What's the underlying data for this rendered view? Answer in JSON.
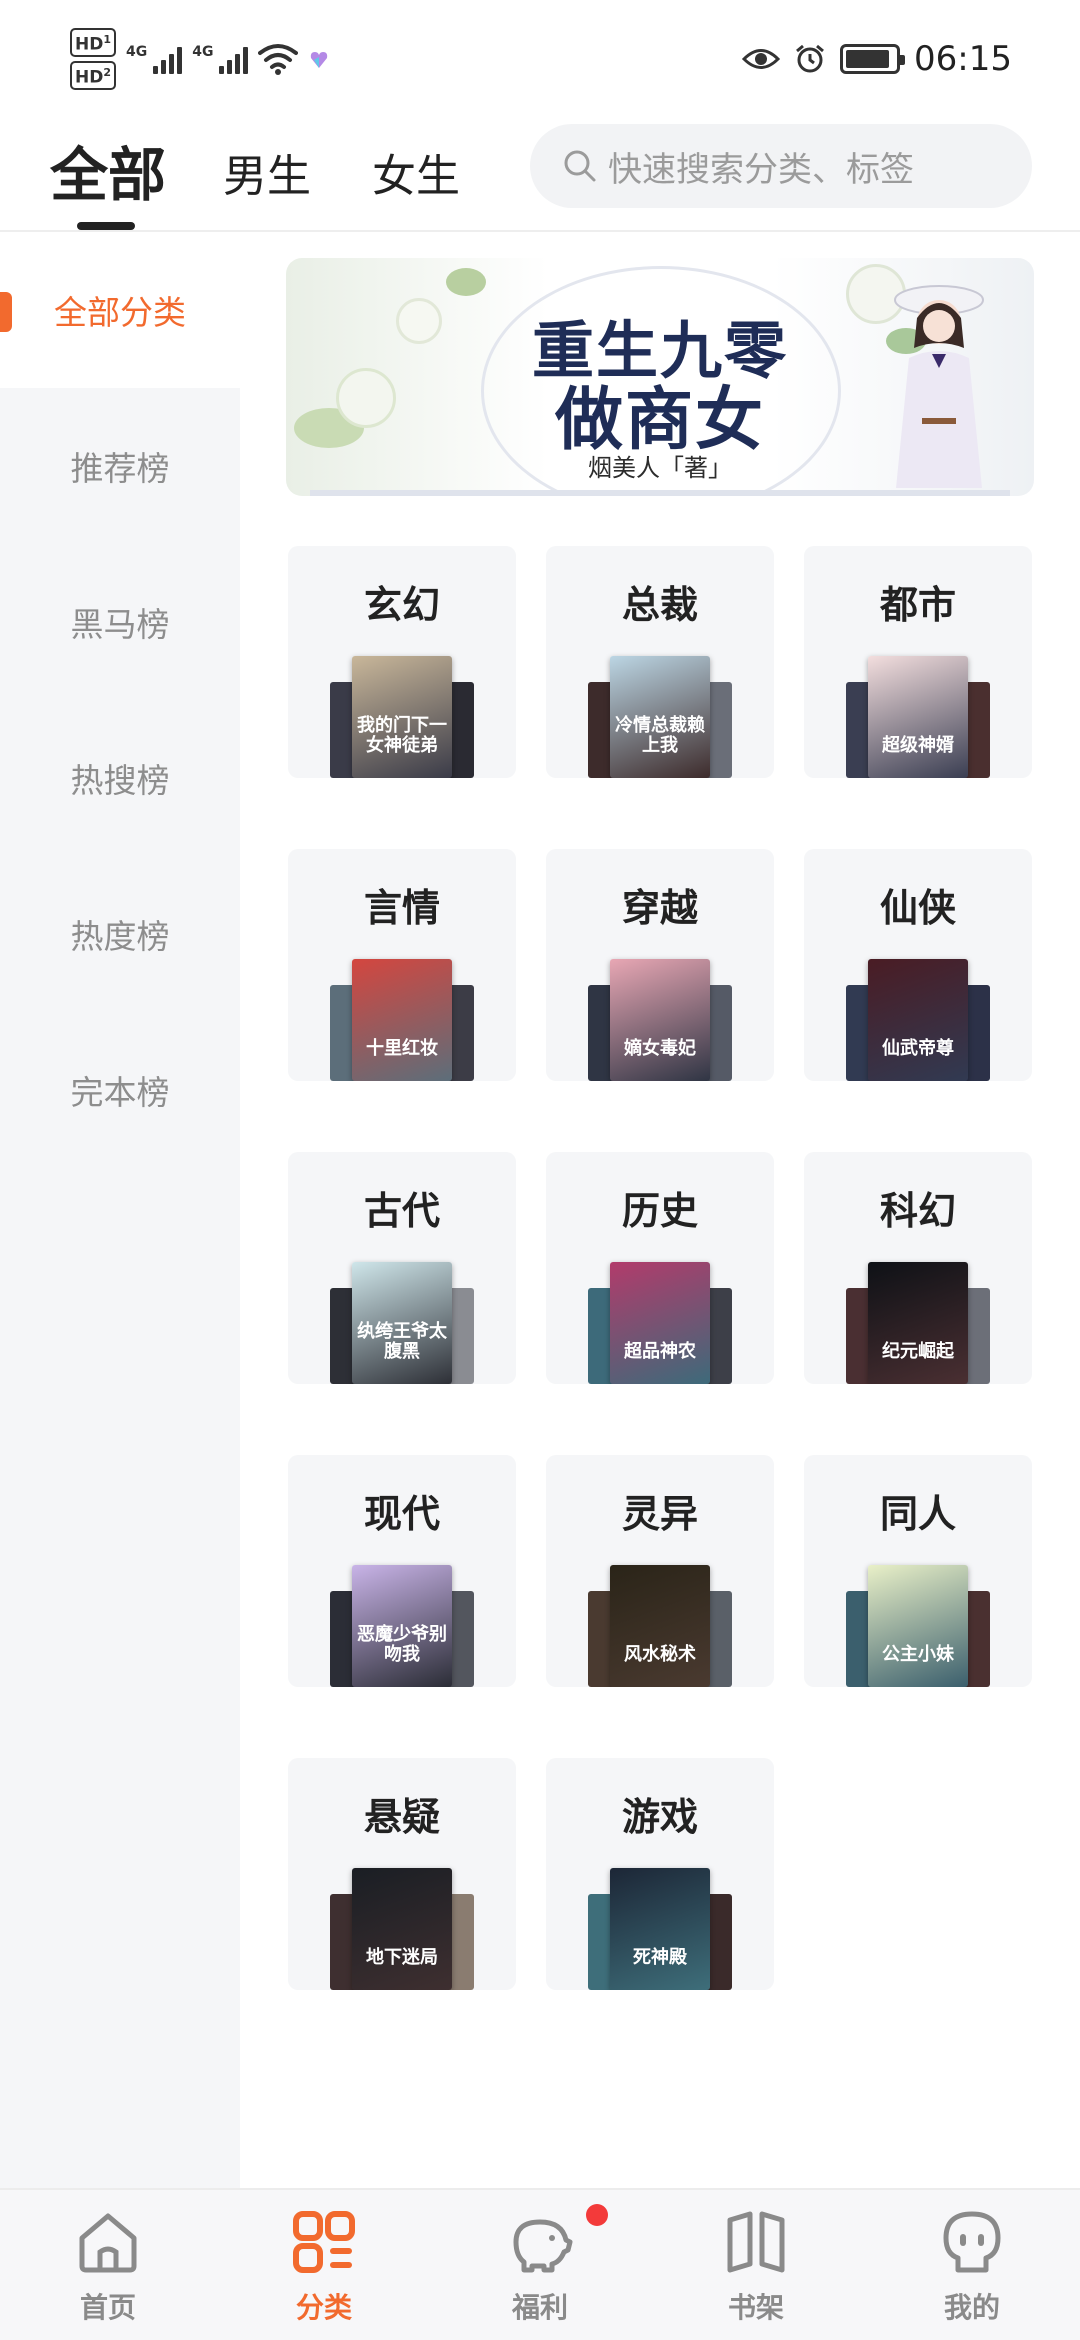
{
  "status_bar": {
    "hd1": "HD",
    "hd2": "HD",
    "sim1": "1",
    "sim2": "2",
    "net1": "4G",
    "net2": "4G",
    "time": "06:15",
    "battery_level": 0.9
  },
  "top_tabs": [
    "全部",
    "男生",
    "女生"
  ],
  "search": {
    "placeholder": "快速搜索分类、标签"
  },
  "sidebar": {
    "items": [
      {
        "label": "全部分类",
        "active": true
      },
      {
        "label": "推荐榜",
        "active": false
      },
      {
        "label": "黑马榜",
        "active": false
      },
      {
        "label": "热搜榜",
        "active": false
      },
      {
        "label": "热度榜",
        "active": false
      },
      {
        "label": "完本榜",
        "active": false
      }
    ]
  },
  "banner": {
    "title_line1": "重生九零",
    "title_line2": "做商女",
    "author": "烟美人「著」"
  },
  "categories": [
    {
      "name": "玄幻",
      "cover_text": "我的门下一女神徒弟",
      "colors": [
        "#3a3b48",
        "#c9b79a",
        "#2a2a32"
      ]
    },
    {
      "name": "总裁",
      "cover_text": "冷情总裁赖上我",
      "colors": [
        "#3d2b2b",
        "#bcd6e4",
        "#6a6e78"
      ]
    },
    {
      "name": "都市",
      "cover_text": "超级神婿",
      "colors": [
        "#3a3e52",
        "#f3dede",
        "#4a2f2f"
      ]
    },
    {
      "name": "言情",
      "cover_text": "十里红妆",
      "colors": [
        "#5c6e7a",
        "#d4463f",
        "#3c3c46"
      ]
    },
    {
      "name": "穿越",
      "cover_text": "嫡女毒妃",
      "colors": [
        "#2f3544",
        "#e8a7b4",
        "#555a66"
      ]
    },
    {
      "name": "仙侠",
      "cover_text": "仙武帝尊",
      "colors": [
        "#313a52",
        "#4a1c24",
        "#2c3148"
      ]
    },
    {
      "name": "古代",
      "cover_text": "纨绔王爷太腹黑",
      "colors": [
        "#2d2f36",
        "#cfe6ea",
        "#8a8c92"
      ]
    },
    {
      "name": "历史",
      "cover_text": "超品神农",
      "colors": [
        "#3d6a7a",
        "#b23b6b",
        "#3d3f48"
      ]
    },
    {
      "name": "科幻",
      "cover_text": "纪元崛起",
      "colors": [
        "#4a2f32",
        "#0e1116",
        "#6c6f78"
      ]
    },
    {
      "name": "现代",
      "cover_text": "恶魔少爷别吻我",
      "colors": [
        "#2b2d36",
        "#c9b4e8",
        "#53565e"
      ]
    },
    {
      "name": "灵异",
      "cover_text": "风水秘术",
      "colors": [
        "#4a3a30",
        "#2a2418",
        "#5a6068"
      ]
    },
    {
      "name": "同人",
      "cover_text": "公主小妹",
      "colors": [
        "#3b5f6d",
        "#e9f0c8",
        "#4a3030"
      ]
    },
    {
      "name": "悬疑",
      "cover_text": "地下迷局",
      "colors": [
        "#3e2f30",
        "#1a1e24",
        "#8a7c70"
      ]
    },
    {
      "name": "游戏",
      "cover_text": "死神殿",
      "colors": [
        "#3e6e7a",
        "#1c2636",
        "#3a2a2a"
      ]
    }
  ],
  "bottom_nav": [
    {
      "label": "首页",
      "icon": "home-icon",
      "active": false
    },
    {
      "label": "分类",
      "icon": "category-grid-icon",
      "active": true
    },
    {
      "label": "福利",
      "icon": "piggy-bank-icon",
      "active": false,
      "badge": true
    },
    {
      "label": "书架",
      "icon": "bookshelf-icon",
      "active": false
    },
    {
      "label": "我的",
      "icon": "profile-face-icon",
      "active": false
    }
  ],
  "accent_color": "#f26a2e"
}
